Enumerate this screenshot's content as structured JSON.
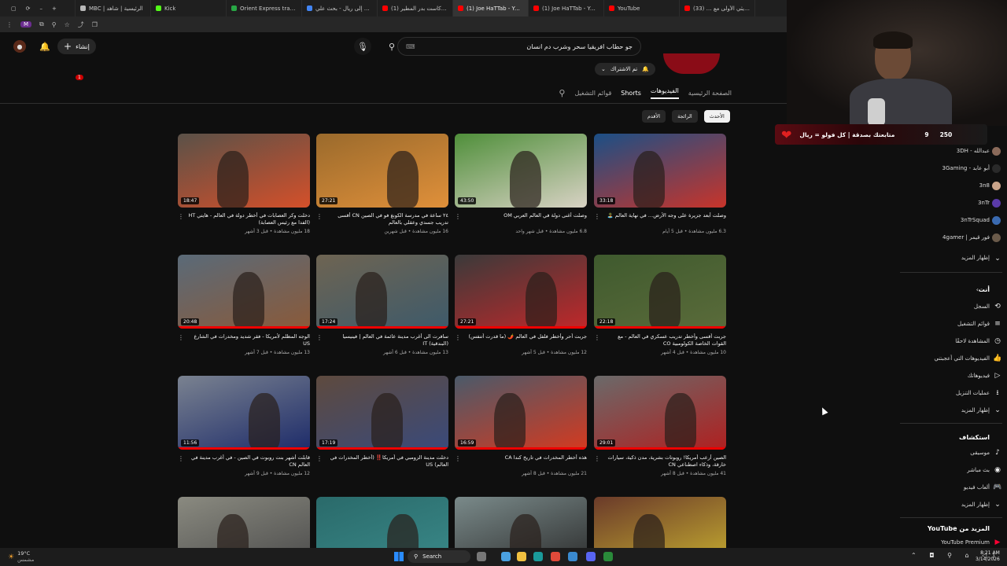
{
  "tabs": [
    {
      "label": "MBC | الرئيسية | شاهد",
      "color": "#b8b8b8"
    },
    {
      "label": "Kick",
      "color": "#53fc18"
    },
    {
      "label": "Orient Express train m…",
      "color": "#28a745"
    },
    {
      "label": "يورو إلى ريال - بحث علي…",
      "color": "#4285f4"
    },
    {
      "label": "(1) بودكاست بدر المطير…",
      "color": "#ff0000"
    },
    {
      "label": "(1) Joe HaTTab - YouT…",
      "color": "#ff0000",
      "active": true
    },
    {
      "label": "(1) Joe HaTTab - YouT…",
      "color": "#ff0000"
    },
    {
      "label": "YouTube",
      "color": "#ff0000"
    },
    {
      "label": "الحريثي الأولى مع … (33)",
      "color": "#ff0000"
    }
  ],
  "addressbar": {
    "profile": "M"
  },
  "header": {
    "create_label": "إنشاء",
    "notif_count": "1",
    "search_value": "جو حطاب افريقيا سحر وشرب دم انسان",
    "subscribed_label": "تم الاشتراك"
  },
  "channel_tabs": [
    "الصفحة الرئيسية",
    "الفيديوهات",
    "Shorts",
    "قوائم التشغيل"
  ],
  "filter_chips": [
    "الأحدث",
    "الرائجة",
    "الأقدم"
  ],
  "videos": [
    {
      "title": "وصلت أبعد جزيرة على وجه الأرض… في نهاية العالم 🏝️",
      "meta": "6.3 مليون مشاهدة • قبل 5 أيام",
      "duration": "33:18",
      "bg": "#1b4f86",
      "accent": "#c8342a"
    },
    {
      "title": "وصلت أغنى دولة في العالم العربي OM",
      "meta": "6.8 مليون مشاهدة • قبل شهر واحد",
      "duration": "43:50",
      "bg": "#4f8f3a",
      "accent": "#d8d2c4"
    },
    {
      "title": "٢٤ ساعة في مدرسة الكونغ فو في الصين CN أقسى تدريب جسدي وعقلي بالعالم",
      "meta": "16 مليون مشاهدة • قبل شهرين",
      "duration": "27:21",
      "bg": "#9a6a2c",
      "accent": "#e0903a"
    },
    {
      "title": "دخلت وكر العصابات في أخطر دولة في العالم - هايتي HT (الفدا مع رئيس العصابة)",
      "meta": "18 مليون مشاهدة • قبل 3 أشهر",
      "duration": "18:47",
      "bg": "#5a5148",
      "accent": "#d4502a"
    },
    {
      "title": "جربت أقسى وأخطر تدريب عسكري في العالم - مع القوات الخاصة الكولومبية CO",
      "meta": "10 مليون مشاهدة • قبل 4 أشهر",
      "duration": "22:18",
      "bg": "#3f5a2e",
      "accent": "#5a6b3a"
    },
    {
      "title": "جربت أحر وأخطر فلفل في العالم 🌶️ (ما قدرت أتنفس)",
      "meta": "12 مليون مشاهدة • قبل 5 أشهر",
      "duration": "27:21",
      "bg": "#3a3a3a",
      "accent": "#c0282a"
    },
    {
      "title": "سافرت الى أغرب مدينة عائمة في العالم | فينيسيا (البندقية) IT",
      "meta": "13 مليون مشاهدة • قبل 6 أشهر",
      "duration": "17:24",
      "bg": "#6e6452",
      "accent": "#3e5a6a"
    },
    {
      "title": "الوجه المظلم لأمريكا - فقر شديد ومخدرات في الشارع US",
      "meta": "13 مليون مشاهدة • قبل 7 أشهر",
      "duration": "20:48",
      "bg": "#5a6a78",
      "accent": "#8a5a3a"
    },
    {
      "title": "الصين أرعب أمريكا! روبوتات بشرية، مدن ذكية، سيارات خارقة، وذكاء اصطناعي CN",
      "meta": "41 مليون مشاهدة • قبل 8 أشهر",
      "duration": "29:01",
      "bg": "#6a6a6a",
      "accent": "#b02020"
    },
    {
      "title": "هذه أخطر المخدرات في تاريخ كندا CA",
      "meta": "21 مليون مشاهدة • قبل 8 أشهر",
      "duration": "16:59",
      "bg": "#4a5a6a",
      "accent": "#d43a20"
    },
    {
      "title": "دخلت مدينة الزومبي في أمريكا‼️ (أخطر المخدرات في العالم) US",
      "meta": "",
      "duration": "17:19",
      "bg": "#5e4a3e",
      "accent": "#3a4a7a"
    },
    {
      "title": "قابلت أشهر بنت روبوت في الصين - في أغرب مدينة في العالم CN",
      "meta": "12 مليون مشاهدة • قبل 9 أشهر",
      "duration": "11:56",
      "bg": "#7a8290",
      "accent": "#1e2c6a"
    },
    {
      "title": "",
      "meta": "",
      "duration": "",
      "bg": "#6a3a2a",
      "accent": "#c8b030"
    },
    {
      "title": "",
      "meta": "",
      "duration": "",
      "bg": "#7a8a8a",
      "accent": "#2a2a2a"
    },
    {
      "title": "",
      "meta": "",
      "duration": "",
      "bg": "#2a6a6a",
      "accent": "#3a8a8a"
    },
    {
      "title": "",
      "meta": "",
      "duration": "",
      "bg": "#8a8a80",
      "accent": "#4a4a4a"
    }
  ],
  "overlay": {
    "text": "متابعتك بصدقة | كل فولو = ريال",
    "count": "250",
    "num": "9"
  },
  "sidebar": {
    "subscriptions": [
      {
        "label": "عبدالله - 3DH",
        "color": "#8a6a5a"
      },
      {
        "label": "أبو عابد - 3Gaming",
        "color": "#2a2a2a"
      },
      {
        "label": "3n8",
        "color": "#c9a48a"
      },
      {
        "label": "3nTr",
        "color": "#5a3aa8"
      },
      {
        "label": "3nTrSquad",
        "color": "#3a6ab0"
      },
      {
        "label": "فور قيمر | 4gamer",
        "color": "#6a5a4a"
      }
    ],
    "show_more": "إظهار المزيد",
    "you_title": "أنت",
    "you_items": [
      {
        "label": "السجل",
        "icon": "history-icon",
        "glyph": "⟲"
      },
      {
        "label": "قوائم التشغيل",
        "icon": "playlists-icon",
        "glyph": "≡"
      },
      {
        "label": "المشاهدة لاحقًا",
        "icon": "clock-icon",
        "glyph": "◷"
      },
      {
        "label": "الفيديوهات التي أعجبتني",
        "icon": "like-icon",
        "glyph": "👍"
      },
      {
        "label": "فيديوهاتك",
        "icon": "your-videos-icon",
        "glyph": "▷"
      },
      {
        "label": "عمليات التنزيل",
        "icon": "download-icon",
        "glyph": "⭳"
      }
    ],
    "explore_title": "استكشاف",
    "explore_items": [
      {
        "label": "موسيقى",
        "icon": "music-icon",
        "glyph": "♪"
      },
      {
        "label": "بث مباشر",
        "icon": "live-icon",
        "glyph": "◉"
      },
      {
        "label": "ألعاب فيديو",
        "icon": "gaming-icon",
        "glyph": "🎮"
      }
    ],
    "more_title": "المزيد من YouTube",
    "premium": "YouTube Premium"
  },
  "taskbar": {
    "weather": "19°C",
    "weather_sub": "مشمس",
    "search": "Search",
    "time": "8:21 AM",
    "date": "3/14/2026"
  }
}
